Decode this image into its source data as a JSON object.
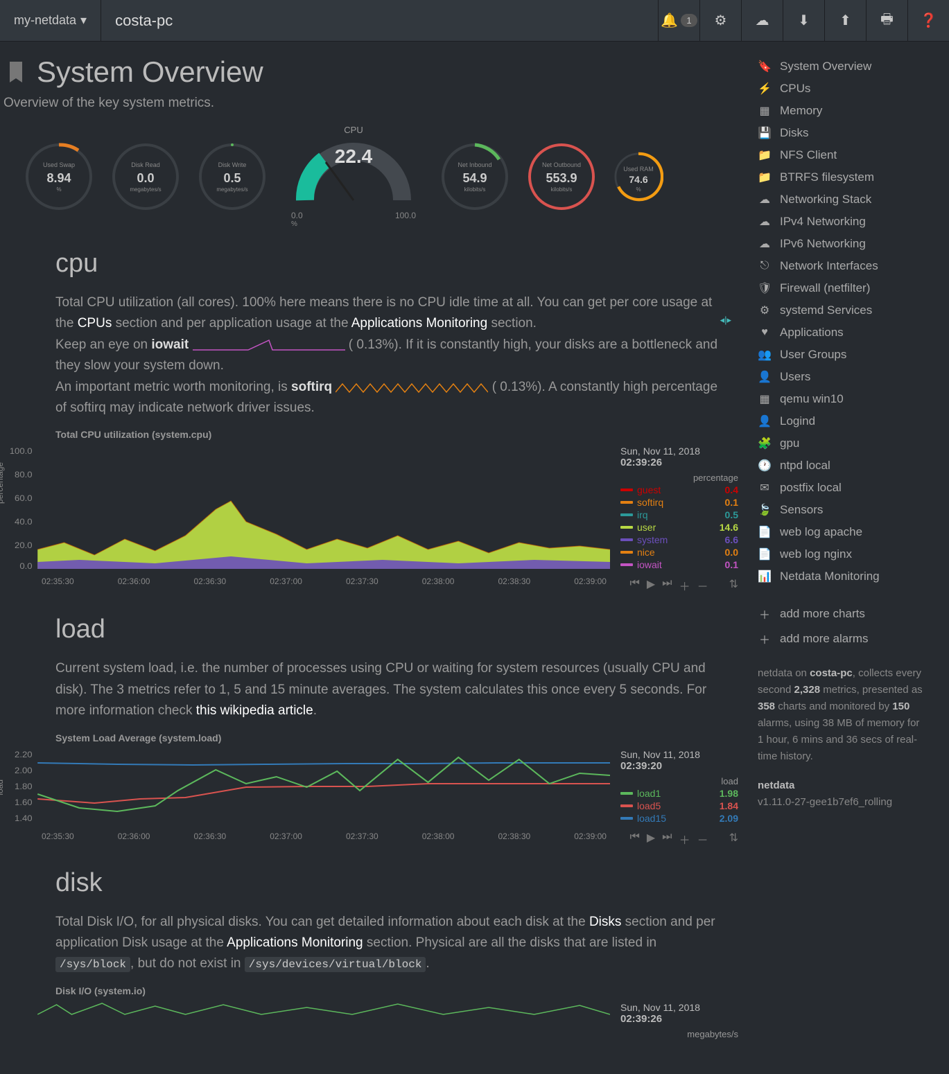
{
  "nav": {
    "brand": "my-netdata",
    "host": "costa-pc",
    "alarm_count": "1"
  },
  "page": {
    "title": "System Overview",
    "subtitle": "Overview of the key system metrics."
  },
  "gauges": {
    "swap": {
      "label": "Used Swap",
      "value": "8.94",
      "unit": "%"
    },
    "disk_read": {
      "label": "Disk Read",
      "value": "0.0",
      "unit": "megabytes/s"
    },
    "disk_write": {
      "label": "Disk Write",
      "value": "0.5",
      "unit": "megabytes/s"
    },
    "cpu": {
      "label": "CPU",
      "value": "22.4",
      "min": "0.0",
      "max": "100.0",
      "unit": "%"
    },
    "net_in": {
      "label": "Net Inbound",
      "value": "54.9",
      "unit": "kilobits/s"
    },
    "net_out": {
      "label": "Net Outbound",
      "value": "553.9",
      "unit": "kilobits/s"
    },
    "ram": {
      "label": "Used RAM",
      "value": "74.6",
      "unit": "%"
    }
  },
  "cpu_section": {
    "heading": "cpu",
    "desc1a": "Total CPU utilization (all cores). 100% here means there is no CPU idle time at all. You can get per core usage at the ",
    "desc1_link1": "CPUs",
    "desc1b": " section and per application usage at the ",
    "desc1_link2": "Applications Monitoring",
    "desc1c": " section.",
    "desc2a": "Keep an eye on ",
    "desc2_bold": "iowait",
    "desc2b": " (      0.13%). If it is constantly high, your disks are a bottleneck and they slow your system down.",
    "desc3a": "An important metric worth monitoring, is ",
    "desc3_bold": "softirq",
    "desc3b": " (      0.13%). A constantly high percentage of softirq may indicate network driver issues."
  },
  "cpu_chart": {
    "title": "Total CPU utilization (system.cpu)",
    "timestamp_date": "Sun, Nov 11, 2018",
    "timestamp_time": "02:39:26",
    "unit": "percentage",
    "ylabel": "percentage",
    "legend": [
      {
        "name": "guest",
        "color": "#CC0000",
        "value": "0.4"
      },
      {
        "name": "softirq",
        "color": "#e38012",
        "value": "0.1"
      },
      {
        "name": "irq",
        "color": "#2c9999",
        "value": "0.5"
      },
      {
        "name": "user",
        "color": "#b8d944",
        "value": "14.6"
      },
      {
        "name": "system",
        "color": "#6b4fbb",
        "value": "6.6"
      },
      {
        "name": "nice",
        "color": "#e38012",
        "value": "0.0"
      },
      {
        "name": "iowait",
        "color": "#c354c3",
        "value": "0.1"
      }
    ],
    "xaxis": [
      "02:35:30",
      "02:36:00",
      "02:36:30",
      "02:37:00",
      "02:37:30",
      "02:38:00",
      "02:38:30",
      "02:39:00"
    ],
    "yaxis": [
      "100.0",
      "80.0",
      "60.0",
      "40.0",
      "20.0",
      "0.0"
    ]
  },
  "load_section": {
    "heading": "load",
    "desc_a": "Current system load, i.e. the number of processes using CPU or waiting for system resources (usually CPU and disk). The 3 metrics refer to 1, 5 and 15 minute averages. The system calculates this once every 5 seconds. For more information check ",
    "desc_link": "this wikipedia article",
    "desc_b": "."
  },
  "load_chart": {
    "title": "System Load Average (system.load)",
    "timestamp_date": "Sun, Nov 11, 2018",
    "timestamp_time": "02:39:20",
    "unit": "load",
    "ylabel": "load",
    "legend": [
      {
        "name": "load1",
        "color": "#5cb85c",
        "value": "1.98"
      },
      {
        "name": "load5",
        "color": "#d9534f",
        "value": "1.84"
      },
      {
        "name": "load15",
        "color": "#337ab7",
        "value": "2.09"
      }
    ],
    "xaxis": [
      "02:35:30",
      "02:36:00",
      "02:36:30",
      "02:37:00",
      "02:37:30",
      "02:38:00",
      "02:38:30",
      "02:39:00"
    ],
    "yaxis": [
      "2.20",
      "2.00",
      "1.80",
      "1.60",
      "1.40"
    ]
  },
  "disk_section": {
    "heading": "disk",
    "desc_a": "Total Disk I/O, for all physical disks. You can get detailed information about each disk at the ",
    "desc_link1": "Disks",
    "desc_b": " section and per application Disk usage at the ",
    "desc_link2": "Applications Monitoring",
    "desc_c": " section. Physical are all the disks that are listed in ",
    "code1": "/sys/block",
    "desc_d": ", but do not exist in ",
    "code2": "/sys/devices/virtual/block",
    "desc_e": "."
  },
  "disk_chart": {
    "title": "Disk I/O (system.io)",
    "timestamp_date": "Sun, Nov 11, 2018",
    "timestamp_time": "02:39:26",
    "unit": "megabytes/s"
  },
  "sidebar": [
    {
      "icon": "bookmark",
      "label": "System Overview"
    },
    {
      "icon": "bolt",
      "label": "CPUs"
    },
    {
      "icon": "chip",
      "label": "Memory"
    },
    {
      "icon": "hdd",
      "label": "Disks"
    },
    {
      "icon": "folder",
      "label": "NFS Client"
    },
    {
      "icon": "folder",
      "label": "BTRFS filesystem"
    },
    {
      "icon": "cloud",
      "label": "Networking Stack"
    },
    {
      "icon": "cloud",
      "label": "IPv4 Networking"
    },
    {
      "icon": "cloud",
      "label": "IPv6 Networking"
    },
    {
      "icon": "sitemap",
      "label": "Network Interfaces"
    },
    {
      "icon": "shield",
      "label": "Firewall (netfilter)"
    },
    {
      "icon": "cogs",
      "label": "systemd Services"
    },
    {
      "icon": "heart",
      "label": "Applications"
    },
    {
      "icon": "users",
      "label": "User Groups"
    },
    {
      "icon": "user",
      "label": "Users"
    },
    {
      "icon": "th",
      "label": "  qemu win10"
    },
    {
      "icon": "user",
      "label": "Logind"
    },
    {
      "icon": "puzzle",
      "label": "gpu"
    },
    {
      "icon": "clock",
      "label": "ntpd local"
    },
    {
      "icon": "envelope",
      "label": "postfix local"
    },
    {
      "icon": "leaf",
      "label": "Sensors"
    },
    {
      "icon": "file",
      "label": "web log apache"
    },
    {
      "icon": "file",
      "label": "web log nginx"
    },
    {
      "icon": "barchart",
      "label": "Netdata Monitoring"
    }
  ],
  "sidebar_actions": [
    {
      "icon": "plus",
      "label": "add more charts"
    },
    {
      "icon": "plus",
      "label": "add more alarms"
    }
  ],
  "footer": {
    "line1a": "netdata on ",
    "line1_host": "costa-pc",
    "line1b": ", collects every second ",
    "line1_metrics": "2,328",
    "line1c": " metrics, presented as ",
    "line1_charts": "358",
    "line1d": " charts and monitored by ",
    "line1_alarms": "150",
    "line1e": " alarms, using 38 MB of memory for 1 hour, 6 mins and 36 secs of real-time history.",
    "line2_bold": "netdata",
    "line2": "v1.11.0-27-gee1b7ef6_rolling"
  },
  "chart_data": [
    {
      "type": "area",
      "title": "Total CPU utilization (system.cpu)",
      "ylabel": "percentage",
      "ylim": [
        0,
        100
      ],
      "x_start": "02:35:30",
      "x_end": "02:39:26",
      "series_snapshot_at_cursor": {
        "guest": 0.4,
        "softirq": 0.1,
        "irq": 0.5,
        "user": 14.6,
        "system": 6.6,
        "nice": 0.0,
        "iowait": 0.1
      },
      "approx_total_stacked_range": [
        10,
        55
      ],
      "peak_time": "02:37:00",
      "peak_value": 55
    },
    {
      "type": "line",
      "title": "System Load Average (system.load)",
      "ylabel": "load",
      "ylim": [
        1.4,
        2.2
      ],
      "x_start": "02:35:30",
      "x_end": "02:39:20",
      "series": [
        {
          "name": "load1",
          "color": "#5cb85c",
          "approx_values_at_ticks": [
            1.7,
            1.55,
            1.6,
            2.0,
            1.9,
            1.8,
            2.15,
            1.9,
            1.98
          ]
        },
        {
          "name": "load5",
          "color": "#d9534f",
          "approx_values_at_ticks": [
            1.65,
            1.6,
            1.65,
            1.78,
            1.8,
            1.8,
            1.85,
            1.85,
            1.84
          ]
        },
        {
          "name": "load15",
          "color": "#337ab7",
          "approx_values_at_ticks": [
            2.08,
            2.07,
            2.06,
            2.07,
            2.08,
            2.08,
            2.09,
            2.09,
            2.09
          ]
        }
      ]
    }
  ]
}
